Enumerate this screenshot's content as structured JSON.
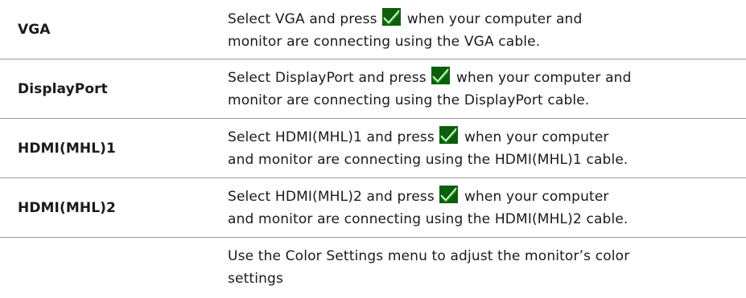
{
  "rows": [
    {
      "label": "VGA",
      "text_before": "Select VGA and press ",
      "text_after": " when your computer and",
      "line2": "monitor are connecting using the VGA cable.",
      "has_check": true
    },
    {
      "label": "DisplayPort",
      "text_before": "Select DisplayPort and press ",
      "text_after": " when your computer and",
      "line2": "monitor are connecting using the DisplayPort cable.",
      "has_check": true
    },
    {
      "label": "HDMI(MHL)1",
      "text_before": "Select HDMI(MHL)1 and press ",
      "text_after": " when your computer",
      "line2": "and monitor are connecting using the HDMI(MHL)1 cable.",
      "has_check": true
    },
    {
      "label": "HDMI(MHL)2",
      "text_before": "Select HDMI(MHL)2 and press ",
      "text_after": " when your computer",
      "line2": "and monitor are connecting using the HDMI(MHL)2 cable.",
      "has_check": true
    },
    {
      "label": "",
      "text_before": "Use the Color Settings menu to adjust the monitor’s color",
      "text_after": "",
      "line2": "settings",
      "has_check": false
    }
  ],
  "icons": {
    "confirm": "check-icon"
  },
  "colors": {
    "check_green": "#22b41e",
    "check_bg": "#0d5e0b",
    "divider": "#9a9a9a",
    "text": "#1a1a1a"
  }
}
